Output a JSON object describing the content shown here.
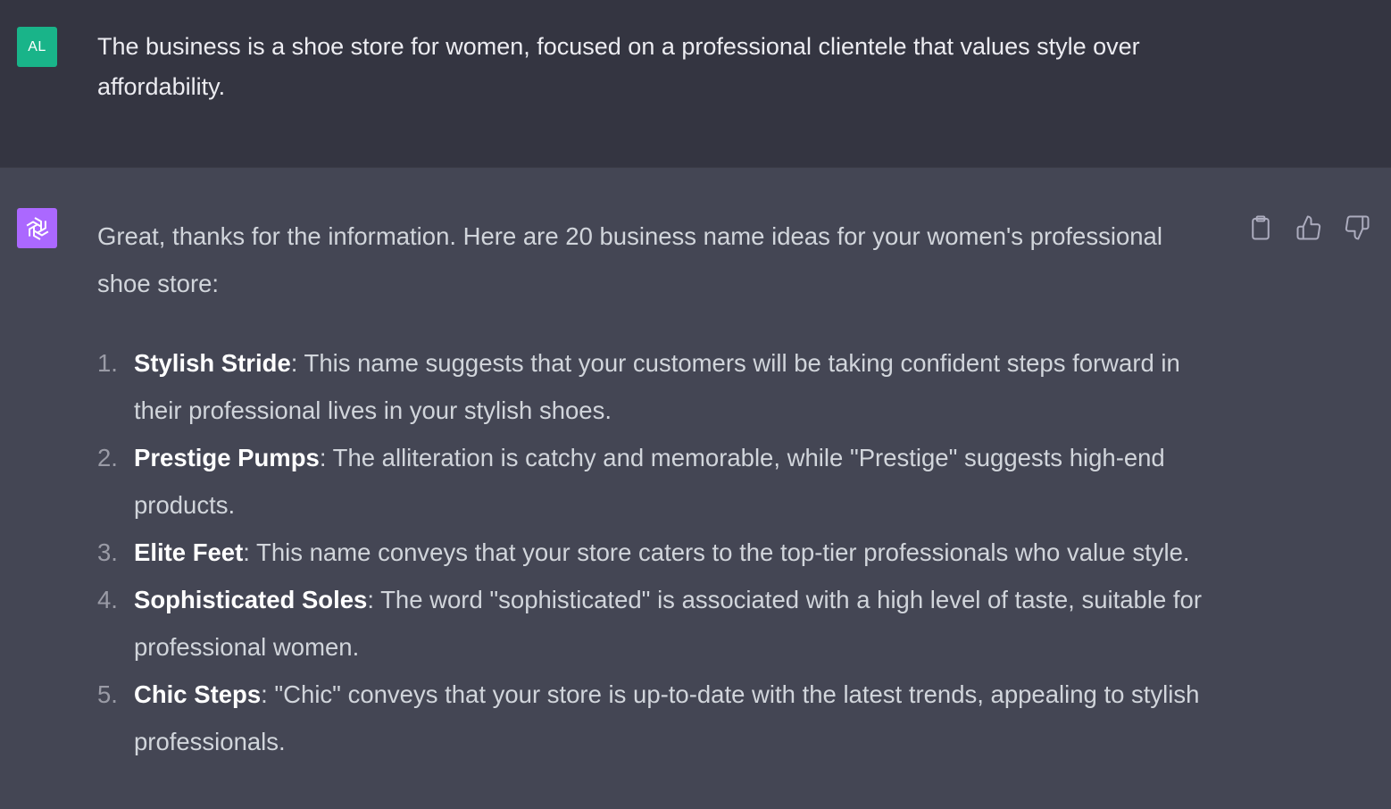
{
  "user_message": {
    "avatar_initials": "AL",
    "text": "The business is a shoe store for women, focused on a professional clientele that values style over affordability."
  },
  "assistant_message": {
    "intro": "Great, thanks for the information. Here are 20 business name ideas for your women's professional shoe store:",
    "ideas": [
      {
        "num": "1.",
        "name": "Stylish Stride",
        "desc": ": This name suggests that your customers will be taking confident steps forward in their professional lives in your stylish shoes."
      },
      {
        "num": "2.",
        "name": "Prestige Pumps",
        "desc": ": The alliteration is catchy and memorable, while \"Prestige\" suggests high-end products."
      },
      {
        "num": "3.",
        "name": "Elite Feet",
        "desc": ": This name conveys that your store caters to the top-tier professionals who value style."
      },
      {
        "num": "4.",
        "name": "Sophisticated Soles",
        "desc": ": The word \"sophisticated\" is associated with a high level of taste, suitable for professional women."
      },
      {
        "num": "5.",
        "name": "Chic Steps",
        "desc": ": \"Chic\" conveys that your store is up-to-date with the latest trends, appealing to stylish professionals."
      }
    ]
  },
  "actions": {
    "copy_icon": "clipboard-icon",
    "like_icon": "thumbs-up-icon",
    "dislike_icon": "thumbs-down-icon"
  },
  "colors": {
    "user_bg": "#343541",
    "assistant_bg": "#444654",
    "user_avatar": "#19b489",
    "bot_avatar": "#ab68ff"
  }
}
